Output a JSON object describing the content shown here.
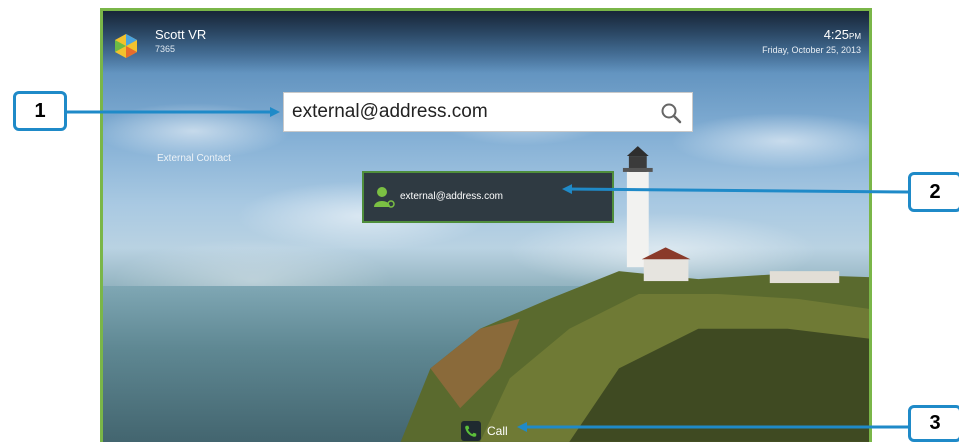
{
  "header": {
    "user_name": "Scott VR",
    "user_extension": "7365",
    "time": "4:25",
    "time_suffix": "PM",
    "date": "Friday, October 25, 2013"
  },
  "search": {
    "value": "external@address.com"
  },
  "results": {
    "section_label": "External Contact",
    "items": [
      {
        "label": "external@address.com"
      }
    ]
  },
  "actions": {
    "call_label": "Call"
  },
  "callouts": [
    "1",
    "2",
    "3"
  ],
  "colors": {
    "screen_border": "#7ab648",
    "callout_blue": "#1f8ac8",
    "result_bg": "#2f3a42",
    "result_border": "#4f8e3c",
    "contact_icon": "#7bc043",
    "call_icon": "#5bbf3a"
  },
  "icons": [
    "app-logo-icon",
    "search-icon",
    "contact-icon",
    "phone-icon"
  ]
}
